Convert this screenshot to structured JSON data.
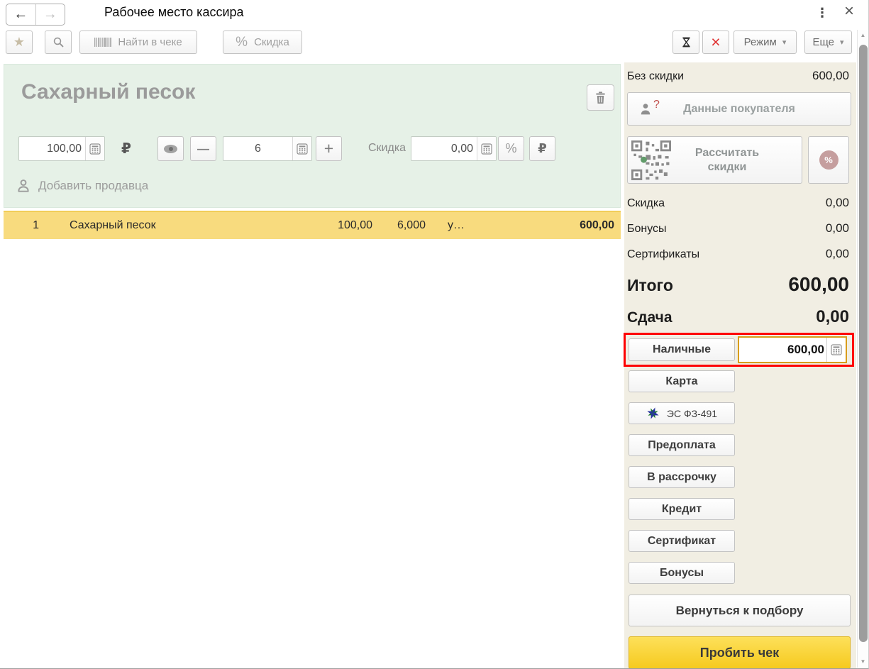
{
  "window": {
    "title": "Рабочее место кассира"
  },
  "icons": {
    "back_arrow": "←",
    "forward_arrow": "→",
    "menu_dots": "⋮",
    "window_close": "×",
    "star": "★",
    "dropdown_caret": "▾",
    "cancel_x": "×",
    "minus": "—",
    "plus": "+",
    "percent": "%",
    "ruble": "₽",
    "question_mark": "?",
    "scroll_up": "▲",
    "scroll_down": "▼"
  },
  "toolbar": {
    "find_in_receipt": "Найти в чеке",
    "discount": "Скидка",
    "mode": "Режим",
    "more": "Еще"
  },
  "product_panel": {
    "name": "Сахарный песок",
    "price": "100,00",
    "currency": "₽",
    "quantity": "6",
    "discount_label": "Скидка",
    "discount_value": "0,00",
    "add_seller": "Добавить продавца"
  },
  "receipt_table": {
    "rows": [
      {
        "num": "1",
        "name": "Сахарный песок",
        "price": "100,00",
        "quantity": "6,000",
        "unit": "у…",
        "sum": "600,00"
      }
    ]
  },
  "summary": {
    "no_discount_label": "Без скидки",
    "no_discount_value": "600,00",
    "customer_data_label": "Данные покупателя",
    "calc_discounts_label": "Рассчитать скидки",
    "discount_label": "Скидка",
    "discount_value": "0,00",
    "bonuses_label": "Бонусы",
    "bonuses_value": "0,00",
    "certificates_label": "Сертификаты",
    "certificates_value": "0,00",
    "total_label": "Итого",
    "total_value": "600,00",
    "change_label": "Сдача",
    "change_value": "0,00"
  },
  "payments": {
    "cash_label": "Наличные",
    "cash_amount": "600,00",
    "card": "Карта",
    "es_fz491": "ЭС ФЗ-491",
    "prepayment": "Предоплата",
    "installment": "В рассрочку",
    "credit": "Кредит",
    "certificate": "Сертификат",
    "bonuses": "Бонусы",
    "back_to_selection": "Вернуться к подбору",
    "submit": "Пробить чек"
  },
  "colors": {
    "panel_green": "#e6f1e7",
    "panel_beige": "#f1eee3",
    "row_highlight": "#f8db7e",
    "submit_yellow": "#f9d33c",
    "annotation_red": "#fe0000",
    "focus_border": "#d89d1b",
    "cancel_red": "#e03131"
  }
}
